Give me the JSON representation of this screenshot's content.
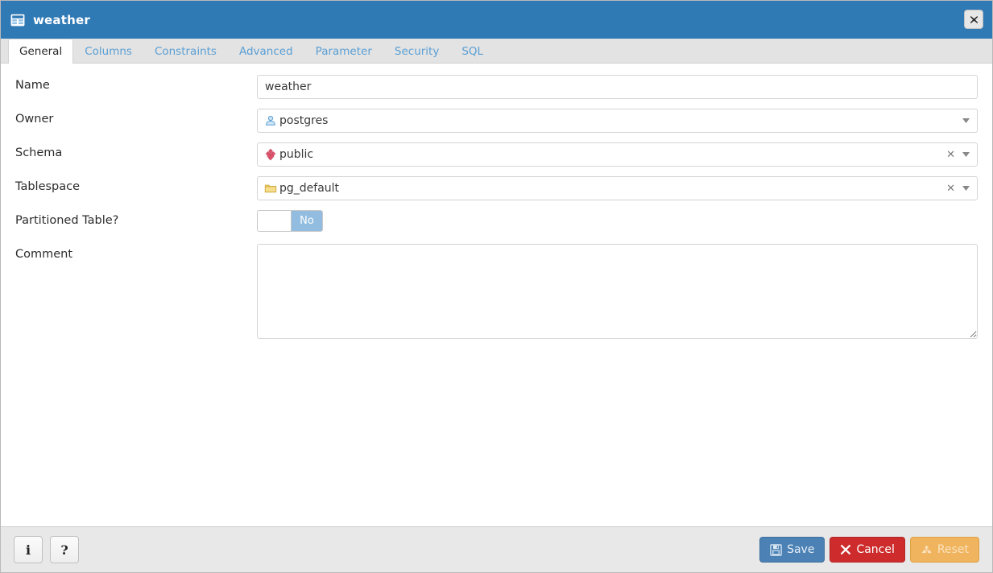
{
  "window": {
    "title": "weather",
    "title_icon": "table-icon",
    "close_icon": "close-icon",
    "accent_color": "#2f79b5"
  },
  "tabs": [
    {
      "label": "General",
      "active": true
    },
    {
      "label": "Columns",
      "active": false
    },
    {
      "label": "Constraints",
      "active": false
    },
    {
      "label": "Advanced",
      "active": false
    },
    {
      "label": "Parameter",
      "active": false
    },
    {
      "label": "Security",
      "active": false
    },
    {
      "label": "SQL",
      "active": false
    }
  ],
  "form": {
    "name": {
      "label": "Name",
      "value": "weather",
      "placeholder": ""
    },
    "owner": {
      "label": "Owner",
      "value": "postgres",
      "icon": "user-icon",
      "clearable": false
    },
    "schema": {
      "label": "Schema",
      "value": "public",
      "icon": "schema-icon",
      "clearable": true,
      "clear_glyph": "✕"
    },
    "tablespace": {
      "label": "Tablespace",
      "value": "pg_default",
      "icon": "folder-icon",
      "clearable": true,
      "clear_glyph": "✕"
    },
    "partitioned": {
      "label": "Partitioned Table?",
      "value": "No",
      "state": "off"
    },
    "comment": {
      "label": "Comment",
      "value": "",
      "placeholder": ""
    }
  },
  "footer": {
    "info_label": "i",
    "help_label": "?",
    "save_label": "Save",
    "cancel_label": "Cancel",
    "reset_label": "Reset",
    "save_color": "#4b81b4",
    "cancel_color": "#ce2c2c",
    "reset_color": "#f0b45e"
  }
}
